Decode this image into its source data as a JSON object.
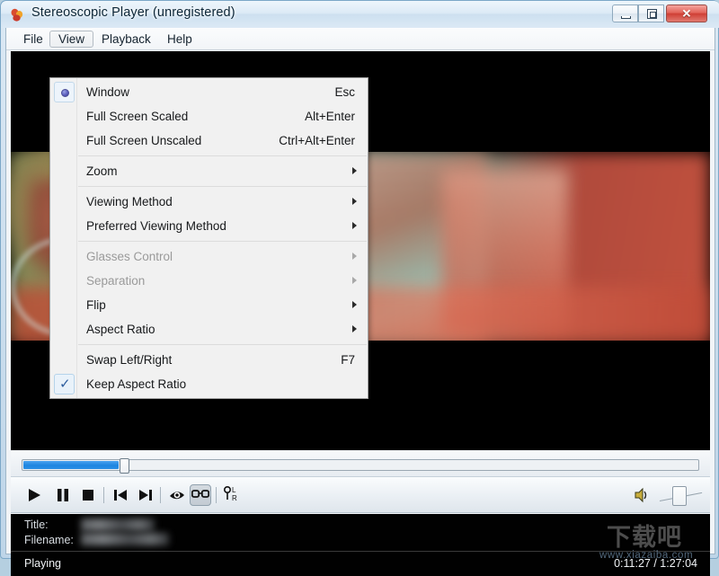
{
  "window": {
    "title": "Stereoscopic Player (unregistered)",
    "app_icon": "stereoscopic-player-icon",
    "controls": {
      "minimize": "Minimize",
      "maximize": "Maximize",
      "close": "Close"
    }
  },
  "menubar": {
    "items": [
      {
        "label": "File",
        "open": false
      },
      {
        "label": "View",
        "open": true
      },
      {
        "label": "Playback",
        "open": false
      },
      {
        "label": "Help",
        "open": false
      }
    ]
  },
  "view_menu": {
    "items": [
      {
        "label": "Window",
        "accel": "Esc",
        "marker": "radio",
        "checked": true,
        "submenu": false,
        "disabled": false
      },
      {
        "label": "Full Screen Scaled",
        "accel": "Alt+Enter",
        "marker": "none",
        "checked": false,
        "submenu": false,
        "disabled": false
      },
      {
        "label": "Full Screen Unscaled",
        "accel": "Ctrl+Alt+Enter",
        "marker": "none",
        "checked": false,
        "submenu": false,
        "disabled": false
      },
      {
        "separator": true
      },
      {
        "label": "Zoom",
        "accel": "",
        "marker": "none",
        "checked": false,
        "submenu": true,
        "disabled": false
      },
      {
        "separator": true
      },
      {
        "label": "Viewing Method",
        "accel": "",
        "marker": "none",
        "checked": false,
        "submenu": true,
        "disabled": false
      },
      {
        "label": "Preferred Viewing Method",
        "accel": "",
        "marker": "none",
        "checked": false,
        "submenu": true,
        "disabled": false
      },
      {
        "separator": true
      },
      {
        "label": "Glasses Control",
        "accel": "",
        "marker": "none",
        "checked": false,
        "submenu": true,
        "disabled": true
      },
      {
        "label": "Separation",
        "accel": "",
        "marker": "none",
        "checked": false,
        "submenu": true,
        "disabled": true
      },
      {
        "label": "Flip",
        "accel": "",
        "marker": "none",
        "checked": false,
        "submenu": true,
        "disabled": false
      },
      {
        "label": "Aspect Ratio",
        "accel": "",
        "marker": "none",
        "checked": false,
        "submenu": true,
        "disabled": false
      },
      {
        "separator": true
      },
      {
        "label": "Swap Left/Right",
        "accel": "F7",
        "marker": "none",
        "checked": false,
        "submenu": false,
        "disabled": false
      },
      {
        "label": "Keep Aspect Ratio",
        "accel": "",
        "marker": "check",
        "checked": true,
        "submenu": false,
        "disabled": false
      }
    ]
  },
  "video": {
    "description": "anaglyph-3d-video-frame"
  },
  "seek": {
    "progress_percent": 14,
    "name": "seek-slider"
  },
  "toolbar": {
    "buttons": [
      {
        "name": "play-button",
        "icon": "play-icon",
        "pressed": false
      },
      {
        "name": "pause-button",
        "icon": "pause-icon",
        "pressed": false
      },
      {
        "name": "stop-button",
        "icon": "stop-icon",
        "pressed": false
      },
      {
        "name": "previous-button",
        "icon": "skip-previous-icon",
        "pressed": false
      },
      {
        "name": "next-button",
        "icon": "skip-next-icon",
        "pressed": false
      },
      {
        "name": "viewing-method-button",
        "icon": "eye-icon",
        "pressed": false
      },
      {
        "name": "glasses-button",
        "icon": "glasses-icon",
        "pressed": true
      },
      {
        "name": "swap-left-right-button",
        "icon": "left-right-switch-icon",
        "pressed": false
      }
    ],
    "volume_icon": "speaker-icon",
    "volume_percent": 100
  },
  "info": {
    "title_label": "Title:",
    "title_value": "",
    "filename_label": "Filename:",
    "filename_value": ""
  },
  "status": {
    "state": "Playing",
    "time": "0:11:27 / 1:27:04"
  },
  "watermark": {
    "cn_text": "下载吧",
    "url_text": "www.xiazaiba.com"
  },
  "colors": {
    "accent_blue": "#1e86e0",
    "close_red": "#cf3f35",
    "menu_bg": "#f1f1f1",
    "panel_black": "#010101"
  }
}
